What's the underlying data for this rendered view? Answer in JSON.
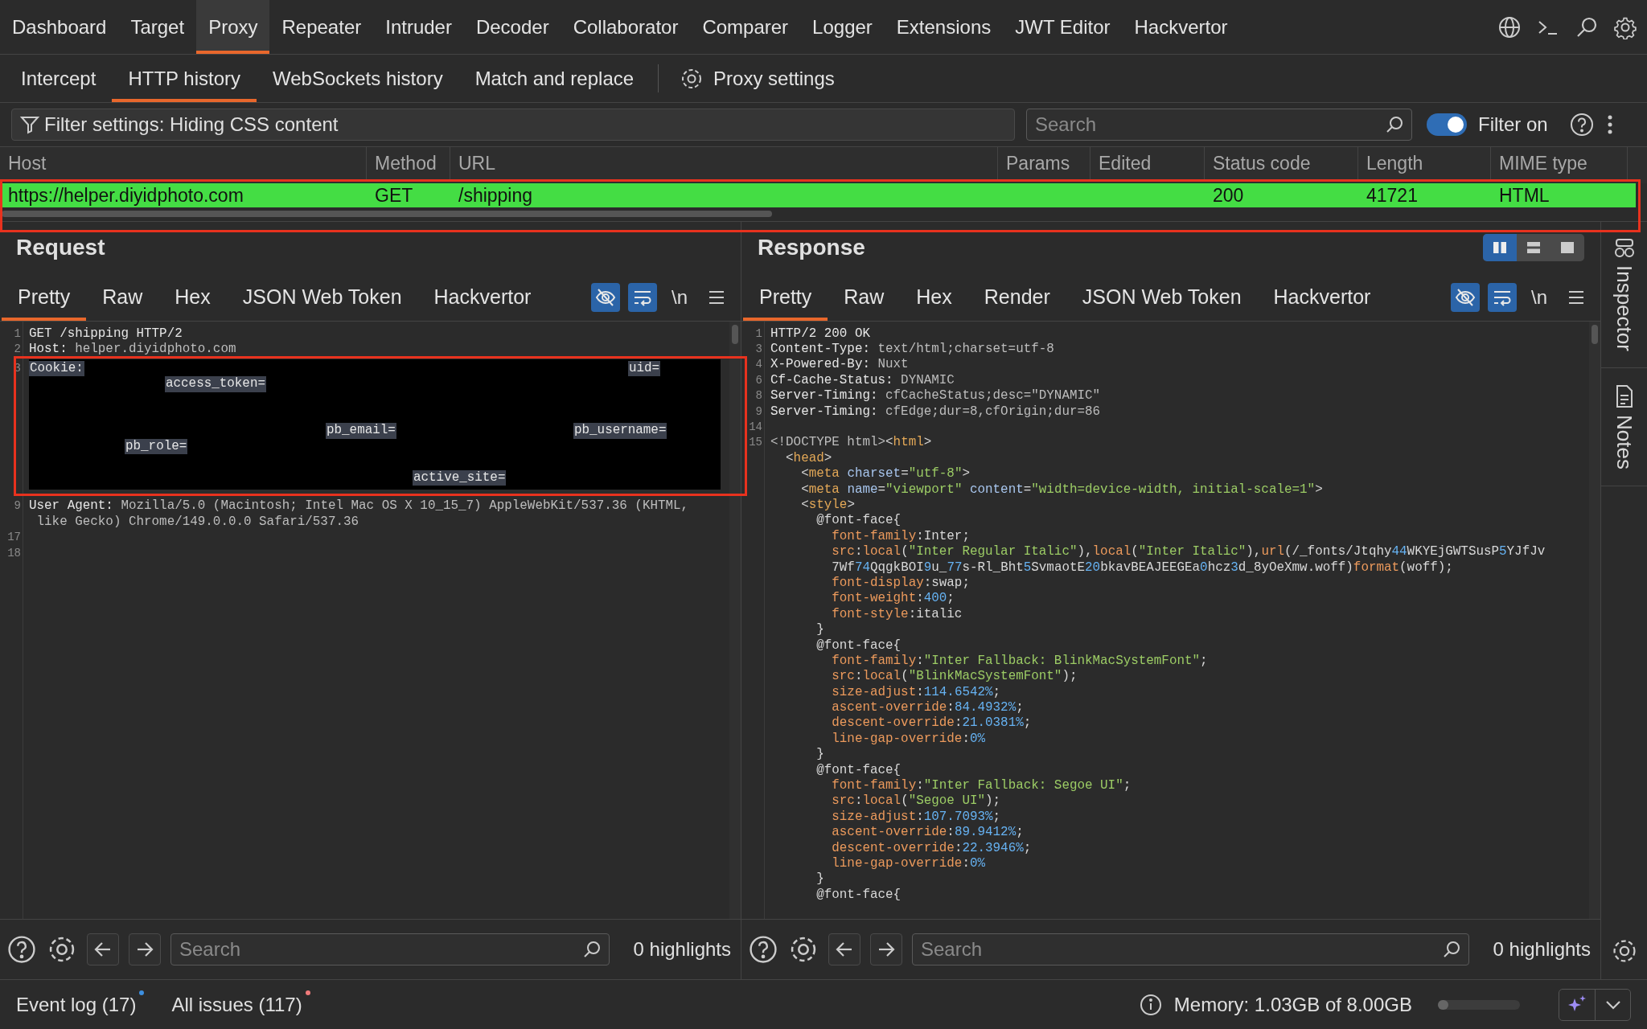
{
  "nav_tabs": [
    {
      "label": "Dashboard",
      "selected": false
    },
    {
      "label": "Target",
      "selected": false
    },
    {
      "label": "Proxy",
      "selected": true
    },
    {
      "label": "Repeater",
      "selected": false
    },
    {
      "label": "Intruder",
      "selected": false
    },
    {
      "label": "Decoder",
      "selected": false
    },
    {
      "label": "Collaborator",
      "selected": false
    },
    {
      "label": "Comparer",
      "selected": false
    },
    {
      "label": "Logger",
      "selected": false
    },
    {
      "label": "Extensions",
      "selected": false
    },
    {
      "label": "JWT Editor",
      "selected": false
    },
    {
      "label": "Hackvertor",
      "selected": false
    }
  ],
  "sub_tabs": [
    {
      "label": "Intercept",
      "selected": false
    },
    {
      "label": "HTTP history",
      "selected": true
    },
    {
      "label": "WebSockets history",
      "selected": false
    },
    {
      "label": "Match and replace",
      "selected": false
    }
  ],
  "proxy_settings": "Proxy settings",
  "filter": {
    "text": "Filter settings: Hiding CSS content"
  },
  "search": {
    "placeholder": "Search"
  },
  "filter_toggle": {
    "label": "Filter on",
    "on": true
  },
  "table": {
    "columns": [
      "Host",
      "Method",
      "URL",
      "Params",
      "Edited",
      "Status code",
      "Length",
      "MIME type"
    ],
    "rows": [
      {
        "cells": [
          "https://helper.diyidphoto.com",
          "GET",
          "/shipping",
          null,
          null,
          "200",
          "41721",
          "HTML"
        ],
        "color": "#44dd44"
      }
    ]
  },
  "request": {
    "title": "Request",
    "tabs": [
      {
        "label": "Pretty",
        "selected": true
      },
      {
        "label": "Raw",
        "selected": false
      },
      {
        "label": "Hex",
        "selected": false
      },
      {
        "label": "JSON Web Token",
        "selected": false
      },
      {
        "label": "Hackvertor",
        "selected": false
      }
    ],
    "tools": [
      {
        "kind": "hide",
        "on": true
      },
      {
        "kind": "wrap",
        "on": true
      },
      {
        "kind": "newline",
        "label": "\\n",
        "on": false
      },
      {
        "kind": "menu",
        "on": false
      }
    ],
    "lines": [
      {
        "kind": "code",
        "number": "1",
        "segments": [
          {
            "kind": "name",
            "text": "GET /shipping HTTP/2"
          }
        ]
      },
      {
        "kind": "code",
        "number": "2",
        "segments": [
          {
            "kind": "name",
            "text": "Host:"
          },
          {
            "kind": "val",
            "text": " helper.diyidphoto.com"
          }
        ]
      },
      {
        "kind": "redacted",
        "number": "3",
        "prefix": "Cookie:",
        "labels": [
          "uid=",
          "access_token=",
          "pb_email=",
          "pb_username=",
          "pb_role=",
          "active_site="
        ]
      },
      {
        "kind": "code",
        "number": "9",
        "segments": [
          {
            "kind": "name",
            "text": "User Agent:"
          },
          {
            "kind": "val",
            "text": " Mozilla/5.0 (Macintosh; Intel Mac OS X 10_15_7) AppleWebKit/537.36 (KHTML,"
          }
        ]
      },
      {
        "kind": "code",
        "segments": [
          {
            "kind": "val",
            "text": " like Gecko) Chrome/149.0.0.0 Safari/537.36"
          }
        ]
      },
      {
        "kind": "code",
        "number": "17"
      },
      {
        "kind": "code",
        "number": "18"
      }
    ],
    "search": {
      "placeholder": "Search"
    },
    "highlights": "0 highlights"
  },
  "response": {
    "title": "Response",
    "view_modes": [
      {
        "kind": "columns",
        "selected": true
      },
      {
        "kind": "rows",
        "selected": false
      },
      {
        "kind": "single",
        "selected": false
      }
    ],
    "tabs": [
      {
        "label": "Pretty",
        "selected": true
      },
      {
        "label": "Raw",
        "selected": false
      },
      {
        "label": "Hex",
        "selected": false
      },
      {
        "label": "Render",
        "selected": false
      },
      {
        "label": "JSON Web Token",
        "selected": false
      },
      {
        "label": "Hackvertor",
        "selected": false
      }
    ],
    "tools": [
      {
        "kind": "hide",
        "on": true
      },
      {
        "kind": "wrap",
        "on": true
      },
      {
        "kind": "newline",
        "label": "\\n",
        "on": false
      },
      {
        "kind": "menu",
        "on": false
      }
    ],
    "lines": [
      {
        "kind": "code",
        "number": "1",
        "segments": [
          {
            "kind": "name",
            "text": "HTTP/2 200 OK"
          }
        ]
      },
      {
        "kind": "code",
        "number": "3",
        "segments": [
          {
            "kind": "name",
            "text": "Content-Type:"
          },
          {
            "kind": "val",
            "text": " text/html;charset=utf-8"
          }
        ]
      },
      {
        "kind": "code",
        "number": "4",
        "segments": [
          {
            "kind": "name",
            "text": "X-Powered-By:"
          },
          {
            "kind": "val",
            "text": " Nuxt"
          }
        ]
      },
      {
        "kind": "code",
        "number": "6",
        "segments": [
          {
            "kind": "name",
            "text": "Cf-Cache-Status:"
          },
          {
            "kind": "val",
            "text": " DYNAMIC"
          }
        ]
      },
      {
        "kind": "code",
        "number": "8",
        "segments": [
          {
            "kind": "name",
            "text": "Server-Timing:"
          },
          {
            "kind": "val",
            "text": " cfCacheStatus;desc=\"DYNAMIC\""
          }
        ]
      },
      {
        "kind": "code",
        "number": "9",
        "segments": [
          {
            "kind": "name",
            "text": "Server-Timing:"
          },
          {
            "kind": "val",
            "text": " cfEdge;dur=8,cfOrigin;dur=86"
          }
        ]
      },
      {
        "kind": "code",
        "number": "14"
      },
      {
        "kind": "code",
        "number": "15",
        "segments": [
          {
            "kind": "val",
            "text": "<!DOCTYPE html>"
          },
          {
            "kind": "plain",
            "text": "<"
          },
          {
            "kind": "tag",
            "text": "html"
          },
          {
            "kind": "plain",
            "text": ">"
          }
        ]
      },
      {
        "kind": "code",
        "segments": [
          {
            "kind": "plain",
            "text": "  <"
          },
          {
            "kind": "tag",
            "text": "head"
          },
          {
            "kind": "plain",
            "text": ">"
          }
        ]
      },
      {
        "kind": "code",
        "segments": [
          {
            "kind": "plain",
            "text": "    <"
          },
          {
            "kind": "tag",
            "text": "meta"
          },
          {
            "kind": "attr",
            "text": " charset"
          },
          {
            "kind": "plain",
            "text": "="
          },
          {
            "kind": "str",
            "text": "\"utf-8\""
          },
          {
            "kind": "plain",
            "text": ">"
          }
        ]
      },
      {
        "kind": "code",
        "segments": [
          {
            "kind": "plain",
            "text": "    <"
          },
          {
            "kind": "tag",
            "text": "meta"
          },
          {
            "kind": "attr",
            "text": " name"
          },
          {
            "kind": "plain",
            "text": "="
          },
          {
            "kind": "str",
            "text": "\"viewport\""
          },
          {
            "kind": "attr",
            "text": " content"
          },
          {
            "kind": "plain",
            "text": "="
          },
          {
            "kind": "str",
            "text": "\"width=device-width, initial-scale=1\""
          },
          {
            "kind": "plain",
            "text": ">"
          }
        ]
      },
      {
        "kind": "code",
        "segments": [
          {
            "kind": "plain",
            "text": "    <"
          },
          {
            "kind": "tag",
            "text": "style"
          },
          {
            "kind": "plain",
            "text": ">"
          }
        ]
      },
      {
        "kind": "code",
        "segments": [
          {
            "kind": "plain",
            "text": "      @font-face{"
          }
        ]
      },
      {
        "kind": "code",
        "segments": [
          {
            "kind": "prop",
            "text": "        font-family"
          },
          {
            "kind": "plain",
            "text": ":Inter;"
          }
        ]
      },
      {
        "kind": "code",
        "segments": [
          {
            "kind": "prop",
            "text": "        src"
          },
          {
            "kind": "plain",
            "text": ":"
          },
          {
            "kind": "prop",
            "text": "local"
          },
          {
            "kind": "plain",
            "text": "("
          },
          {
            "kind": "str",
            "text": "\"Inter Regular Italic\""
          },
          {
            "kind": "plain",
            "text": "),"
          },
          {
            "kind": "prop",
            "text": "local"
          },
          {
            "kind": "plain",
            "text": "("
          },
          {
            "kind": "str",
            "text": "\"Inter Italic\""
          },
          {
            "kind": "plain",
            "text": "),"
          },
          {
            "kind": "prop",
            "text": "url"
          },
          {
            "kind": "plain",
            "text": "(/_fonts/Jtqhy"
          },
          {
            "kind": "num",
            "text": "44"
          },
          {
            "kind": "plain",
            "text": "WKYEjGWTSusP"
          },
          {
            "kind": "num",
            "text": "5"
          },
          {
            "kind": "plain",
            "text": "YJfJv"
          }
        ]
      },
      {
        "kind": "code",
        "segments": [
          {
            "kind": "plain",
            "text": "        7Wf"
          },
          {
            "kind": "num",
            "text": "74"
          },
          {
            "kind": "plain",
            "text": "QqgkBOI"
          },
          {
            "kind": "num",
            "text": "9"
          },
          {
            "kind": "plain",
            "text": "u_"
          },
          {
            "kind": "num",
            "text": "77"
          },
          {
            "kind": "plain",
            "text": "s-Rl_Bht"
          },
          {
            "kind": "num",
            "text": "5"
          },
          {
            "kind": "plain",
            "text": "SvmaotE"
          },
          {
            "kind": "num",
            "text": "20"
          },
          {
            "kind": "plain",
            "text": "bkavBEAJEEGEa"
          },
          {
            "kind": "num",
            "text": "0"
          },
          {
            "kind": "plain",
            "text": "hcz"
          },
          {
            "kind": "num",
            "text": "3"
          },
          {
            "kind": "plain",
            "text": "d_8yOeXmw.woff)"
          },
          {
            "kind": "prop",
            "text": "format"
          },
          {
            "kind": "plain",
            "text": "(woff);"
          }
        ]
      },
      {
        "kind": "code",
        "segments": [
          {
            "kind": "prop",
            "text": "        font-display"
          },
          {
            "kind": "plain",
            "text": ":swap;"
          }
        ]
      },
      {
        "kind": "code",
        "segments": [
          {
            "kind": "prop",
            "text": "        font-weight"
          },
          {
            "kind": "plain",
            "text": ":"
          },
          {
            "kind": "num",
            "text": "400"
          },
          {
            "kind": "plain",
            "text": ";"
          }
        ]
      },
      {
        "kind": "code",
        "segments": [
          {
            "kind": "prop",
            "text": "        font-style"
          },
          {
            "kind": "plain",
            "text": ":italic"
          }
        ]
      },
      {
        "kind": "code",
        "segments": [
          {
            "kind": "plain",
            "text": "      }"
          }
        ]
      },
      {
        "kind": "code",
        "segments": [
          {
            "kind": "plain",
            "text": "      @font-face{"
          }
        ]
      },
      {
        "kind": "code",
        "segments": [
          {
            "kind": "prop",
            "text": "        font-family"
          },
          {
            "kind": "plain",
            "text": ":"
          },
          {
            "kind": "str",
            "text": "\"Inter Fallback: BlinkMacSystemFont\""
          },
          {
            "kind": "plain",
            "text": ";"
          }
        ]
      },
      {
        "kind": "code",
        "segments": [
          {
            "kind": "prop",
            "text": "        src"
          },
          {
            "kind": "plain",
            "text": ":"
          },
          {
            "kind": "prop",
            "text": "local"
          },
          {
            "kind": "plain",
            "text": "("
          },
          {
            "kind": "str",
            "text": "\"BlinkMacSystemFont\""
          },
          {
            "kind": "plain",
            "text": ");"
          }
        ]
      },
      {
        "kind": "code",
        "segments": [
          {
            "kind": "prop",
            "text": "        size-adjust"
          },
          {
            "kind": "plain",
            "text": ":"
          },
          {
            "kind": "num",
            "text": "114.6542%"
          },
          {
            "kind": "plain",
            "text": ";"
          }
        ]
      },
      {
        "kind": "code",
        "segments": [
          {
            "kind": "prop",
            "text": "        ascent-override"
          },
          {
            "kind": "plain",
            "text": ":"
          },
          {
            "kind": "num",
            "text": "84.4932%"
          },
          {
            "kind": "plain",
            "text": ";"
          }
        ]
      },
      {
        "kind": "code",
        "segments": [
          {
            "kind": "prop",
            "text": "        descent-override"
          },
          {
            "kind": "plain",
            "text": ":"
          },
          {
            "kind": "num",
            "text": "21.0381%"
          },
          {
            "kind": "plain",
            "text": ";"
          }
        ]
      },
      {
        "kind": "code",
        "segments": [
          {
            "kind": "prop",
            "text": "        line-gap-override"
          },
          {
            "kind": "plain",
            "text": ":"
          },
          {
            "kind": "num",
            "text": "0%"
          }
        ]
      },
      {
        "kind": "code",
        "segments": [
          {
            "kind": "plain",
            "text": "      }"
          }
        ]
      },
      {
        "kind": "code",
        "segments": [
          {
            "kind": "plain",
            "text": "      @font-face{"
          }
        ]
      },
      {
        "kind": "code",
        "segments": [
          {
            "kind": "prop",
            "text": "        font-family"
          },
          {
            "kind": "plain",
            "text": ":"
          },
          {
            "kind": "str",
            "text": "\"Inter Fallback: Segoe UI\""
          },
          {
            "kind": "plain",
            "text": ";"
          }
        ]
      },
      {
        "kind": "code",
        "segments": [
          {
            "kind": "prop",
            "text": "        src"
          },
          {
            "kind": "plain",
            "text": ":"
          },
          {
            "kind": "prop",
            "text": "local"
          },
          {
            "kind": "plain",
            "text": "("
          },
          {
            "kind": "str",
            "text": "\"Segoe UI\""
          },
          {
            "kind": "plain",
            "text": ");"
          }
        ]
      },
      {
        "kind": "code",
        "segments": [
          {
            "kind": "prop",
            "text": "        size-adjust"
          },
          {
            "kind": "plain",
            "text": ":"
          },
          {
            "kind": "num",
            "text": "107.7093%"
          },
          {
            "kind": "plain",
            "text": ";"
          }
        ]
      },
      {
        "kind": "code",
        "segments": [
          {
            "kind": "prop",
            "text": "        ascent-override"
          },
          {
            "kind": "plain",
            "text": ":"
          },
          {
            "kind": "num",
            "text": "89.9412%"
          },
          {
            "kind": "plain",
            "text": ";"
          }
        ]
      },
      {
        "kind": "code",
        "segments": [
          {
            "kind": "prop",
            "text": "        descent-override"
          },
          {
            "kind": "plain",
            "text": ":"
          },
          {
            "kind": "num",
            "text": "22.3946%"
          },
          {
            "kind": "plain",
            "text": ";"
          }
        ]
      },
      {
        "kind": "code",
        "segments": [
          {
            "kind": "prop",
            "text": "        line-gap-override"
          },
          {
            "kind": "plain",
            "text": ":"
          },
          {
            "kind": "num",
            "text": "0%"
          }
        ]
      },
      {
        "kind": "code",
        "segments": [
          {
            "kind": "plain",
            "text": "      }"
          }
        ]
      },
      {
        "kind": "code",
        "segments": [
          {
            "kind": "plain",
            "text": "      @font-face{"
          }
        ]
      }
    ],
    "search": {
      "placeholder": "Search"
    },
    "highlights": "0 highlights"
  },
  "sidebar": {
    "items": [
      {
        "kind": "inspector",
        "label": "Inspector"
      },
      {
        "kind": "notes",
        "label": "Notes"
      }
    ]
  },
  "status_bar": {
    "items": [
      {
        "label": "Event log (17)",
        "color": "#3d8fe0"
      },
      {
        "label": "All issues (117)",
        "color": "#f07b7b"
      }
    ],
    "memory": "Memory: 1.03GB of 8.00GB",
    "level": 0.13
  }
}
